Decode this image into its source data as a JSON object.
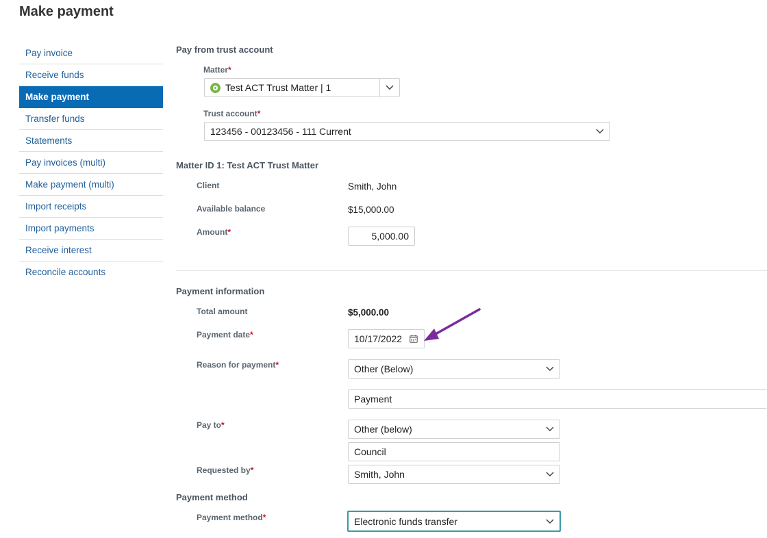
{
  "page": {
    "title": "Make payment"
  },
  "sidebar": {
    "items": [
      {
        "label": "Pay invoice",
        "active": false
      },
      {
        "label": "Receive funds",
        "active": false
      },
      {
        "label": "Make payment",
        "active": true
      },
      {
        "label": "Transfer funds",
        "active": false
      },
      {
        "label": "Statements",
        "active": false
      },
      {
        "label": "Pay invoices (multi)",
        "active": false
      },
      {
        "label": "Make payment (multi)",
        "active": false
      },
      {
        "label": "Import receipts",
        "active": false
      },
      {
        "label": "Import payments",
        "active": false
      },
      {
        "label": "Receive interest",
        "active": false
      },
      {
        "label": "Reconcile accounts",
        "active": false
      }
    ]
  },
  "trust": {
    "section_title": "Pay from trust account",
    "matter_label": "Matter",
    "matter_value": "Test ACT Trust Matter | 1",
    "trust_account_label": "Trust account",
    "trust_account_value": "123456 - 00123456 - 111 Current"
  },
  "matter_details": {
    "section_title": "Matter ID 1: Test ACT Trust Matter",
    "client_label": "Client",
    "client_value": "Smith, John",
    "balance_label": "Available balance",
    "balance_value": "$15,000.00",
    "amount_label": "Amount",
    "amount_value": "5,000.00"
  },
  "payment_info": {
    "section_title": "Payment information",
    "total_label": "Total amount",
    "total_value": "$5,000.00",
    "date_label": "Payment date",
    "date_value": "10/17/2022",
    "reason_label": "Reason for payment",
    "reason_value": "Other (Below)",
    "reason_text": "Payment",
    "pay_to_label": "Pay to",
    "pay_to_value": "Other (below)",
    "pay_to_text": "Council",
    "requested_by_label": "Requested by",
    "requested_by_value": "Smith, John"
  },
  "payment_method": {
    "section_title": "Payment method",
    "method_label": "Payment method",
    "method_value": "Electronic funds transfer"
  },
  "required_marker": "*",
  "colors": {
    "accent": "#0a6bb5",
    "link": "#1f5f9a",
    "required": "#c8102e",
    "annotation_arrow": "#7b2a9e",
    "focus_border": "#3a9aa4",
    "matter_icon": "#7ab648"
  },
  "icons": {
    "matter": "matter-circle-icon",
    "dropdown": "chevron-down-icon",
    "date": "calendar-icon",
    "annotation": "arrow-annotation-icon"
  }
}
